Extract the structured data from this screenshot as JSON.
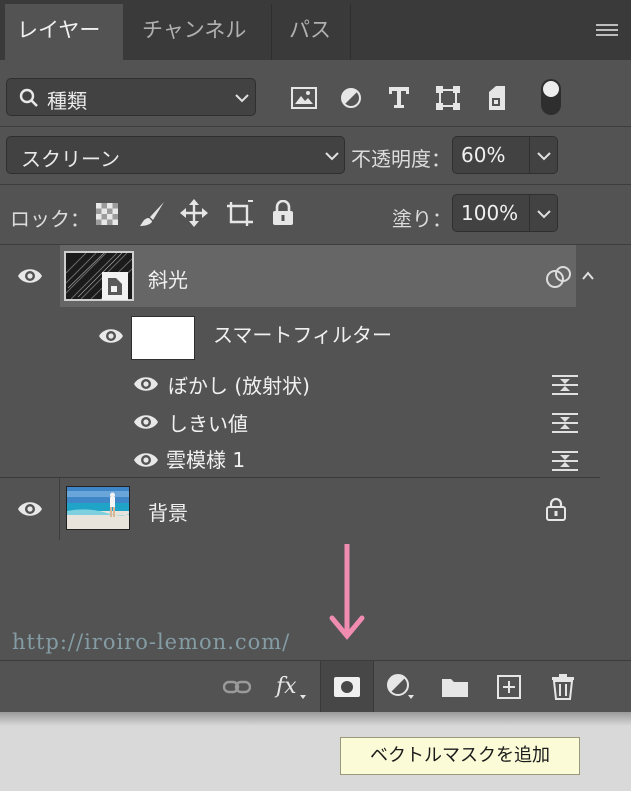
{
  "tabs": [
    {
      "label": "レイヤー",
      "active": true
    },
    {
      "label": "チャンネル",
      "active": false
    },
    {
      "label": "パス",
      "active": false
    }
  ],
  "filter": {
    "kind_label": "種類"
  },
  "blend": {
    "mode": "スクリーン",
    "opacity_label": "不透明度：",
    "opacity_value": "60%"
  },
  "lock": {
    "label": "ロック：",
    "fill_label": "塗り：",
    "fill_value": "100%"
  },
  "layers": {
    "smart": {
      "name": "斜光"
    },
    "smart_filters_label": "スマートフィルター",
    "filters": [
      {
        "name": "ぼかし (放射状)"
      },
      {
        "name": "しきい値"
      },
      {
        "name": "雲模様 1"
      }
    ],
    "background": {
      "name": "背景"
    }
  },
  "watermark": "http://iroiro-lemon.com/",
  "tooltip": "ベクトルマスクを追加",
  "colors": {
    "panel": "#535353",
    "selected_row": "#666666",
    "arrow": "#f08cb0",
    "tooltip_bg": "#fbfbd8"
  }
}
